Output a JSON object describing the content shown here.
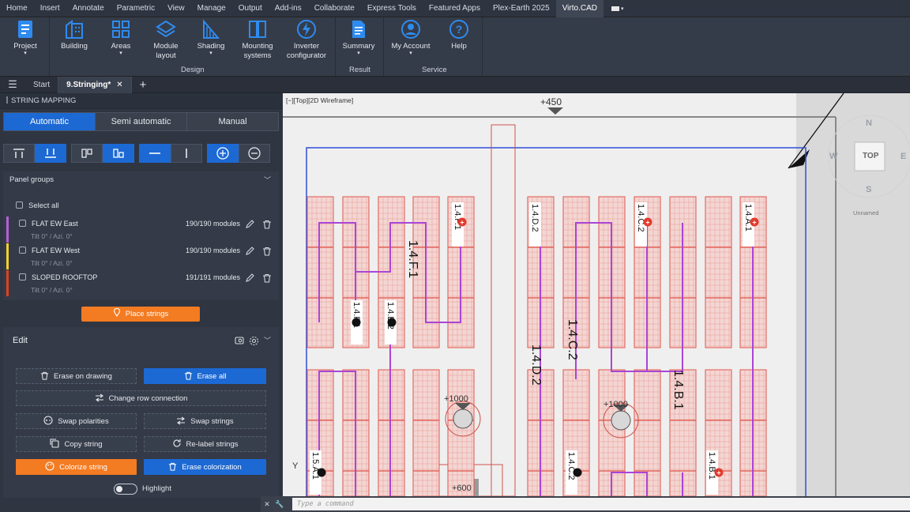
{
  "menu": [
    "Home",
    "Insert",
    "Annotate",
    "Parametric",
    "View",
    "Manage",
    "Output",
    "Add-ins",
    "Collaborate",
    "Express Tools",
    "Featured Apps",
    "Plex-Earth 2025",
    "Virto.CAD"
  ],
  "ribbon": {
    "project": "Project",
    "building": "Building",
    "areas": "Areas",
    "module_layout_1": "Module",
    "module_layout_2": "layout",
    "shading": "Shading",
    "mounting_1": "Mounting",
    "mounting_2": "systems",
    "inverter_1": "Inverter",
    "inverter_2": "configurator",
    "summary": "Summary",
    "account": "My Account",
    "help": "Help",
    "group_design": "Design",
    "group_result": "Result",
    "group_service": "Service"
  },
  "tabs": {
    "start": "Start",
    "current": "9.Stringing*",
    "close": "✕"
  },
  "panel": {
    "title": "STRING MAPPING",
    "modes": [
      "Automatic",
      "Semi automatic",
      "Manual"
    ],
    "groups_header": "Panel groups",
    "select_all": "Select all",
    "groups": [
      {
        "name": "FLAT EW East",
        "tilt": "Tilt 0° / Azi. 0°",
        "count": "190/190 modules",
        "color": "#b55fd6"
      },
      {
        "name": "FLAT EW West",
        "tilt": "Tilt 0° / Azi. 0°",
        "count": "190/190 modules",
        "color": "#f2d12a"
      },
      {
        "name": "SLOPED ROOFTOP",
        "tilt": "Tilt 0° / Azi. 0°",
        "count": "191/191 modules",
        "color": "#e0421c"
      }
    ],
    "place_strings": "Place strings",
    "edit_header": "Edit",
    "erase_on_drawing": "Erase on drawing",
    "erase_all": "Erase all",
    "change_row": "Change row connection",
    "swap_polarities": "Swap polarities",
    "swap_strings": "Swap strings",
    "copy_string": "Copy string",
    "relabel": "Re-label strings",
    "colorize": "Colorize string",
    "erase_colorization": "Erase colorization",
    "highlight": "Highlight"
  },
  "viewport": {
    "label": "[−][Top][2D Wireframe]",
    "elev_450": "+450",
    "elev_1000a": "+1000",
    "elev_1000b": "+1000",
    "elev_600": "+600",
    "cube_top": "TOP",
    "cube_n": "N",
    "cube_s": "S",
    "cube_w": "W",
    "cube_e": "E",
    "unnamed": "Unnamed",
    "axis_y": "Y",
    "string_labels": {
      "F1a": "1.4.F.1",
      "F1b": "1.4.F.1",
      "F1c": "1.4.F.1",
      "E2": "1.4.E.2",
      "D2a": "1.4.D.2",
      "D2b": "1.4.D.2",
      "C2a": "1.4.C.2",
      "C2b": "1.4.C.2",
      "C2c": "1.4.C.2",
      "A1": "1.4.A.1",
      "B1a": "1.4.B.1",
      "B1b": "1.4.B.1",
      "A15": "1.5.A.1"
    }
  },
  "cmd_placeholder": "Type a command"
}
